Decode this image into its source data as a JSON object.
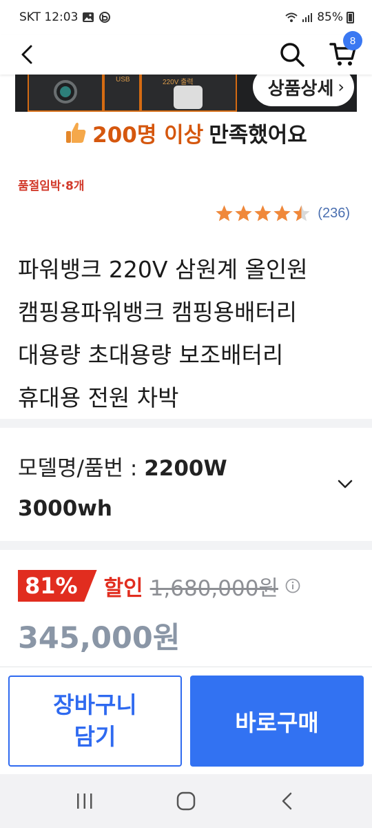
{
  "status_bar": {
    "carrier_time": "SKT 12:03",
    "battery": "85%"
  },
  "header": {
    "cart_count": "8"
  },
  "product_image": {
    "detail_label": "상품상세",
    "detail_arrow": "›",
    "usb_label": "USB",
    "ac_label": "220V 출력"
  },
  "satisfaction": {
    "highlight": "200명 이상",
    "rest": "만족했어요"
  },
  "stock": {
    "text": "품절임박·8개"
  },
  "rating": {
    "value": 4.5,
    "max": 5,
    "count": "(236)",
    "star_color": "#f0883a"
  },
  "product": {
    "title_lines": [
      "파워뱅크 220V 삼원계 올인원",
      "캠핑용파워뱅크 캠핑용배터리",
      "대용량 초대용량 보조배터리",
      "휴대용 전원 차박"
    ]
  },
  "model": {
    "label": "모델명/품번 : ",
    "value_line1": "2200W",
    "value_line2": "3000wh"
  },
  "price": {
    "discount": "81%",
    "discount_label": "할인",
    "original": "1,680,000원",
    "final": "345,000원"
  },
  "actions": {
    "cart_line1": "장바구니",
    "cart_line2": "담기",
    "buy": "바로구매"
  },
  "colors": {
    "accent": "#3272f2",
    "discount": "#e12d1f",
    "highlight": "#d5570e"
  }
}
